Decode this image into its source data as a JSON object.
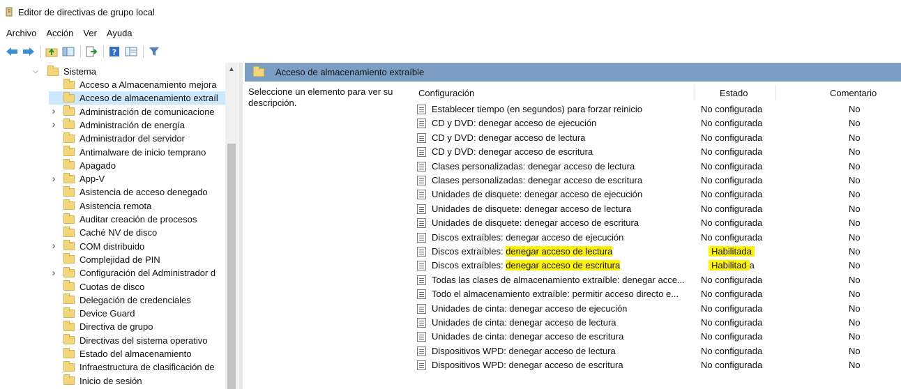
{
  "window": {
    "title": "Editor de directivas de grupo local"
  },
  "menu": [
    "Archivo",
    "Acción",
    "Ver",
    "Ayuda"
  ],
  "toolbar": [
    "back-arrow-icon",
    "forward-arrow-icon",
    "up-folder-icon",
    "show-hide-tree-icon",
    "export-list-icon",
    "help-icon",
    "extended-view-icon",
    "filter-icon"
  ],
  "tree": {
    "root": "Sistema",
    "items": [
      {
        "label": "Acceso a Almacenamiento mejora",
        "expandable": false
      },
      {
        "label": "Acceso de almacenamiento extraíl",
        "expandable": false,
        "selected": true
      },
      {
        "label": "Administración de comunicacione",
        "expandable": true
      },
      {
        "label": "Administración de energía",
        "expandable": true
      },
      {
        "label": "Administrador del servidor",
        "expandable": false
      },
      {
        "label": "Antimalware de inicio temprano",
        "expandable": false
      },
      {
        "label": "Apagado",
        "expandable": false
      },
      {
        "label": "App-V",
        "expandable": true
      },
      {
        "label": "Asistencia de acceso denegado",
        "expandable": false
      },
      {
        "label": "Asistencia remota",
        "expandable": false
      },
      {
        "label": "Auditar creación de procesos",
        "expandable": false
      },
      {
        "label": "Caché NV de disco",
        "expandable": false
      },
      {
        "label": "COM distribuido",
        "expandable": true
      },
      {
        "label": "Complejidad de PIN",
        "expandable": false
      },
      {
        "label": "Configuración del Administrador d",
        "expandable": true
      },
      {
        "label": "Cuotas de disco",
        "expandable": false
      },
      {
        "label": "Delegación de credenciales",
        "expandable": false
      },
      {
        "label": "Device Guard",
        "expandable": false
      },
      {
        "label": "Directiva de grupo",
        "expandable": false
      },
      {
        "label": "Directivas del sistema operativo",
        "expandable": false
      },
      {
        "label": "Estado del almacenamiento",
        "expandable": false
      },
      {
        "label": "Infraestructura de clasificación de",
        "expandable": false
      },
      {
        "label": "Inicio de sesión",
        "expandable": false
      }
    ]
  },
  "details": {
    "header": "Acceso de almacenamiento extraíble",
    "description": "Seleccione un elemento para ver su descripción.",
    "columns": {
      "config": "Configuración",
      "state": "Estado",
      "comment": "Comentario"
    },
    "rows": [
      {
        "config": "Establecer tiempo (en segundos) para forzar reinicio",
        "state": "No configurada",
        "comment": "No"
      },
      {
        "config": "CD y DVD: denegar acceso de ejecución",
        "state": "No configurada",
        "comment": "No"
      },
      {
        "config": "CD y DVD: denegar acceso de lectura",
        "state": "No configurada",
        "comment": "No"
      },
      {
        "config": "CD y DVD: denegar acceso de escritura",
        "state": "No configurada",
        "comment": "No"
      },
      {
        "config": "Clases personalizadas: denegar acceso de lectura",
        "state": "No configurada",
        "comment": "No"
      },
      {
        "config": "Clases personalizadas: denegar acceso de escritura",
        "state": "No configurada",
        "comment": "No"
      },
      {
        "config": "Unidades de disquete: denegar acceso de ejecución",
        "state": "No configurada",
        "comment": "No"
      },
      {
        "config": "Unidades de disquete: denegar acceso de lectura",
        "state": "No configurada",
        "comment": "No"
      },
      {
        "config": "Unidades de disquete: denegar acceso de escritura",
        "state": "No configurada",
        "comment": "No"
      },
      {
        "config": "Discos extraíbles: denegar acceso de ejecución",
        "state": "No configurada",
        "comment": "No"
      },
      {
        "config_prefix": "Discos extraíbles: ",
        "config_highlight": "denegar acceso de lectura",
        "state_highlight": "Habilitada",
        "state_rest": "",
        "comment": "No"
      },
      {
        "config_prefix": "Discos extraíbles: ",
        "config_highlight": "denegar acceso de escritura",
        "state_highlight": "Habilitad",
        "state_rest": "a",
        "comment": "No"
      },
      {
        "config": "Todas las clases de almacenamiento extraíble: denegar acce...",
        "state": "No configurada",
        "comment": "No"
      },
      {
        "config": "Todo el almacenamiento extraíble: permitir acceso directo e...",
        "state": "No configurada",
        "comment": "No"
      },
      {
        "config": "Unidades de cinta: denegar acceso de ejecución",
        "state": "No configurada",
        "comment": "No"
      },
      {
        "config": "Unidades de cinta: denegar acceso de lectura",
        "state": "No configurada",
        "comment": "No"
      },
      {
        "config": "Unidades de cinta: denegar acceso de escritura",
        "state": "No configurada",
        "comment": "No"
      },
      {
        "config": "Dispositivos WPD: denegar acceso de lectura",
        "state": "No configurada",
        "comment": "No"
      },
      {
        "config": "Dispositivos WPD: denegar acceso de escritura",
        "state": "No configurada",
        "comment": "No"
      }
    ]
  },
  "colors": {
    "header_bar": "#7b9ec2",
    "selection": "#cce8ff",
    "highlight": "#fff200",
    "folder": "#f3d67a"
  }
}
